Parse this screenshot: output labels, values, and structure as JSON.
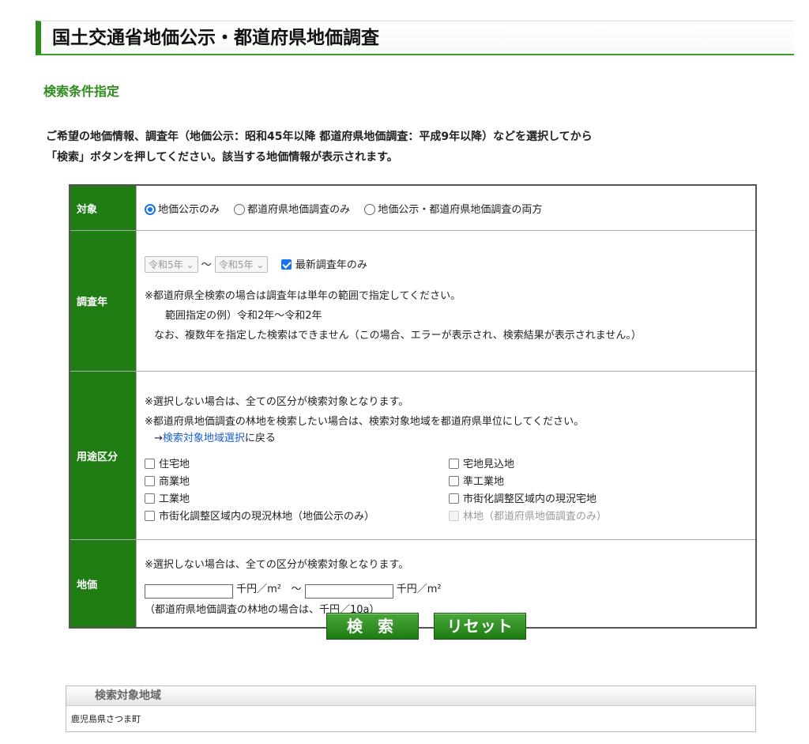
{
  "page_title": "国土交通省地価公示・都道府県地価調査",
  "section_heading": "検索条件指定",
  "intro": [
    "ご希望の地価情報、調査年（地価公示：昭和45年以降 都道府県地価調査：平成9年以降）などを選択してから",
    "「検索」ボタンを押してください。該当する地価情報が表示されます。"
  ],
  "target": {
    "label": "対象",
    "options": [
      "地価公示のみ",
      "都道府県地価調査のみ",
      "地価公示・都道府県地価調査の両方"
    ],
    "selected": 0
  },
  "survey_year": {
    "label": "調査年",
    "from": "令和5年",
    "tilde": "～",
    "to": "令和5年",
    "latest_only_label": "最新調査年のみ",
    "latest_only_checked": true,
    "note1": "※都道府県全検索の場合は調査年は単年の範囲で指定してください。",
    "note2": "範囲指定の例）令和2年～令和2年",
    "note3": "なお、複数年を指定した検索はできません（この場合、エラーが表示され、検索結果が表示されません。）"
  },
  "usage": {
    "label": "用途区分",
    "note1": "※選択しない場合は、全ての区分が検索対象となります。",
    "note2": "※都道府県地価調査の林地を検索したい場合は、検索対象地域を都道府県単位にしてください。",
    "arrow": "→",
    "link_text": "検索対象地域選択",
    "link_suffix": "に戻る",
    "options": [
      {
        "label": "住宅地",
        "disabled": false
      },
      {
        "label": "宅地見込地",
        "disabled": false
      },
      {
        "label": "商業地",
        "disabled": false
      },
      {
        "label": "準工業地",
        "disabled": false
      },
      {
        "label": "工業地",
        "disabled": false
      },
      {
        "label": "市街化調整区域内の現況宅地",
        "disabled": false
      },
      {
        "label": "市街化調整区域内の現況林地（地価公示のみ）",
        "disabled": false
      },
      {
        "label": "林地（都道府県地価調査のみ）",
        "disabled": true
      }
    ]
  },
  "price": {
    "label": "地価",
    "note": "※選択しない場合は、全ての区分が検索対象となります。",
    "unit1": "千円／m²",
    "tilde": "～",
    "unit2": "千円／m²",
    "from_value": "",
    "to_value": "",
    "forest_note": "（都道府県地価調査の林地の場合は、千円／10a）"
  },
  "buttons": {
    "search": "検 索",
    "reset": "リセット"
  },
  "region": {
    "heading": "検索対象地域",
    "value": "鹿児島県さつま町"
  }
}
